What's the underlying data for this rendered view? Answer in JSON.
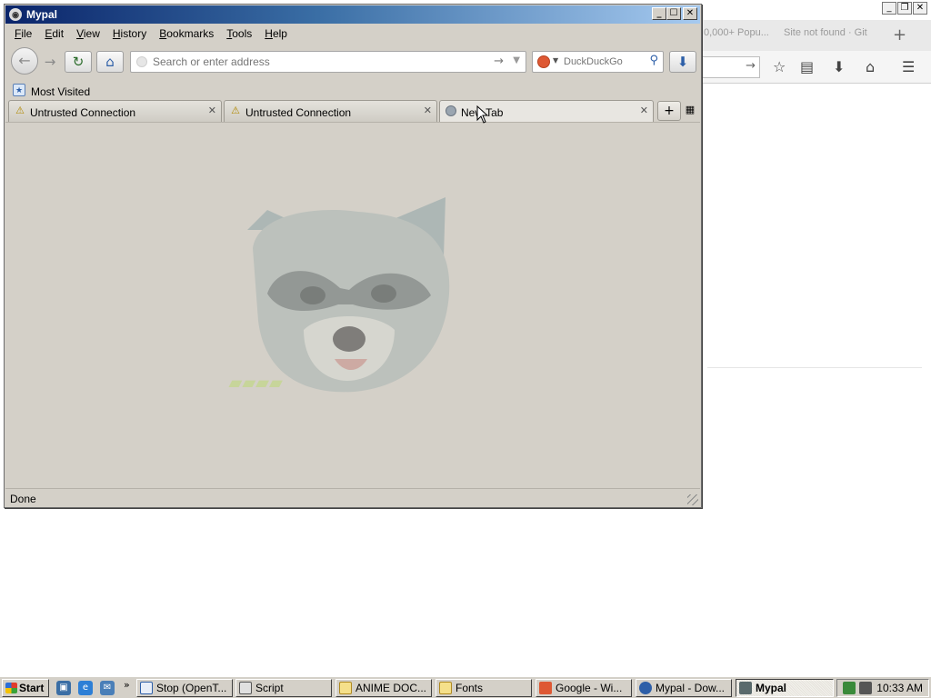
{
  "background_window": {
    "tabs": [
      {
        "label": "0,000+ Popu..."
      },
      {
        "label": "Site not found · Git"
      }
    ],
    "controls": {
      "minimize": "_",
      "restore": "❐",
      "close": "✕"
    }
  },
  "window": {
    "title": "Mypal",
    "controls": {
      "minimize": "_",
      "maximize": "☐",
      "close": "✕"
    }
  },
  "menu": {
    "items": [
      {
        "label": "File"
      },
      {
        "label": "Edit"
      },
      {
        "label": "View"
      },
      {
        "label": "History"
      },
      {
        "label": "Bookmarks"
      },
      {
        "label": "Tools"
      },
      {
        "label": "Help"
      }
    ]
  },
  "navbar": {
    "url_value": "",
    "url_placeholder": "Search or enter address",
    "search_engine": "DuckDuckGo",
    "search_placeholder": "DuckDuckGo"
  },
  "bookmarks": {
    "items": [
      {
        "label": "Most Visited"
      }
    ]
  },
  "tabs": [
    {
      "label": "Untrusted Connection",
      "icon": "warning-icon",
      "active": false
    },
    {
      "label": "Untrusted Connection",
      "icon": "warning-icon",
      "active": false
    },
    {
      "label": "New Tab",
      "icon": "globe-icon",
      "active": true
    }
  ],
  "status": {
    "text": "Done"
  },
  "taskbar": {
    "start_label": "Start",
    "tasks": [
      {
        "label": "Stop (OpenT..."
      },
      {
        "label": "Script"
      },
      {
        "label": "ANIME DOC..."
      },
      {
        "label": "Fonts"
      },
      {
        "label": "Google - Wi..."
      },
      {
        "label": "Mypal - Dow..."
      },
      {
        "label": "Mypal"
      }
    ],
    "clock": "10:33 AM"
  },
  "colors": {
    "titlebar_start": "#0a246a",
    "titlebar_end": "#a6caf0",
    "window_bg": "#d4d0c8",
    "duckduckgo": "#de5833"
  }
}
